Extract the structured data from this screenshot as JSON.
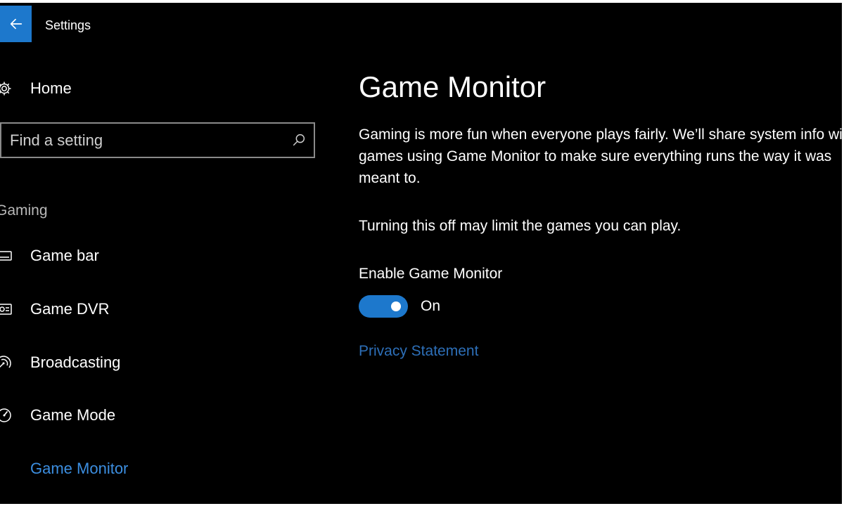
{
  "window": {
    "title": "Settings",
    "back_icon": "arrow-left-icon"
  },
  "sidebar": {
    "home": {
      "label": "Home",
      "icon": "gear-icon"
    },
    "search": {
      "placeholder": "Find a setting",
      "icon": "search-icon"
    },
    "section": "Gaming",
    "items": [
      {
        "label": "Game bar",
        "icon": "game-bar-icon"
      },
      {
        "label": "Game DVR",
        "icon": "game-dvr-icon"
      },
      {
        "label": "Broadcasting",
        "icon": "broadcasting-icon"
      },
      {
        "label": "Game Mode",
        "icon": "game-mode-icon"
      },
      {
        "label": "Game Monitor",
        "icon": "",
        "active": true
      }
    ]
  },
  "main": {
    "title": "Game Monitor",
    "description": "Gaming is more fun when everyone plays fairly. We’ll share system info with games using Game Monitor to make sure everything runs the way it was meant to.",
    "warning": "Turning this off may limit the games you can play.",
    "toggle": {
      "label": "Enable Game Monitor",
      "state": "On",
      "on": true
    },
    "privacy_link": "Privacy Statement"
  },
  "colors": {
    "accent": "#1d78cc",
    "link": "#2d6fb8",
    "active_nav": "#3c8ee0",
    "background": "#000000"
  }
}
